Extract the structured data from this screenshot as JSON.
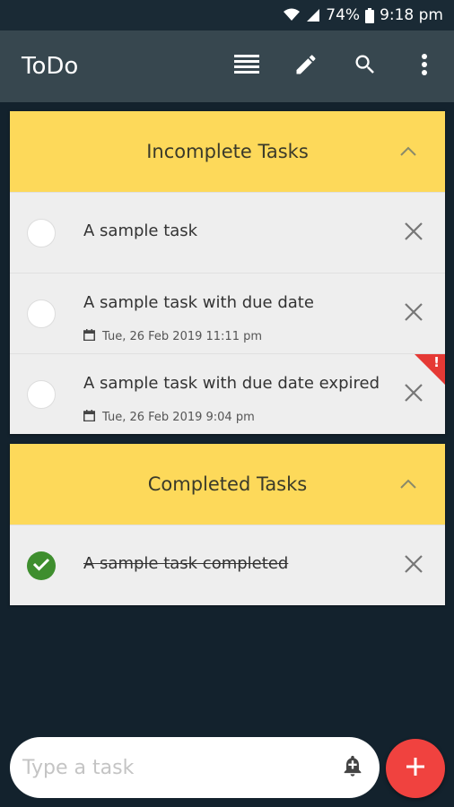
{
  "status_bar": {
    "battery": "74%",
    "time": "9:18 pm",
    "icons": [
      "wifi-icon",
      "signal-icon",
      "battery-icon"
    ]
  },
  "app_bar": {
    "title": "ToDo",
    "actions": [
      "list-icon",
      "edit-icon",
      "search-icon",
      "more-vert-icon"
    ]
  },
  "incomplete": {
    "title": "Incomplete Tasks",
    "tasks": [
      {
        "text": "A sample task"
      },
      {
        "text": "A sample task with due date",
        "due": "Tue, 26 Feb 2019 11:11 pm"
      },
      {
        "text": "A sample task with due date expired",
        "due": "Tue, 26 Feb 2019 9:04 pm",
        "expired_mark": "!"
      }
    ]
  },
  "completed": {
    "title": "Completed Tasks",
    "tasks": [
      {
        "text": "A sample task completed"
      }
    ]
  },
  "input": {
    "placeholder": "Type a task"
  },
  "colors": {
    "background": "#13222d",
    "app_bar": "#37474f",
    "section_header": "#fdd95a",
    "completed_check": "#3e8e2e",
    "expired_flag": "#e53935",
    "fab": "#f0423f"
  }
}
